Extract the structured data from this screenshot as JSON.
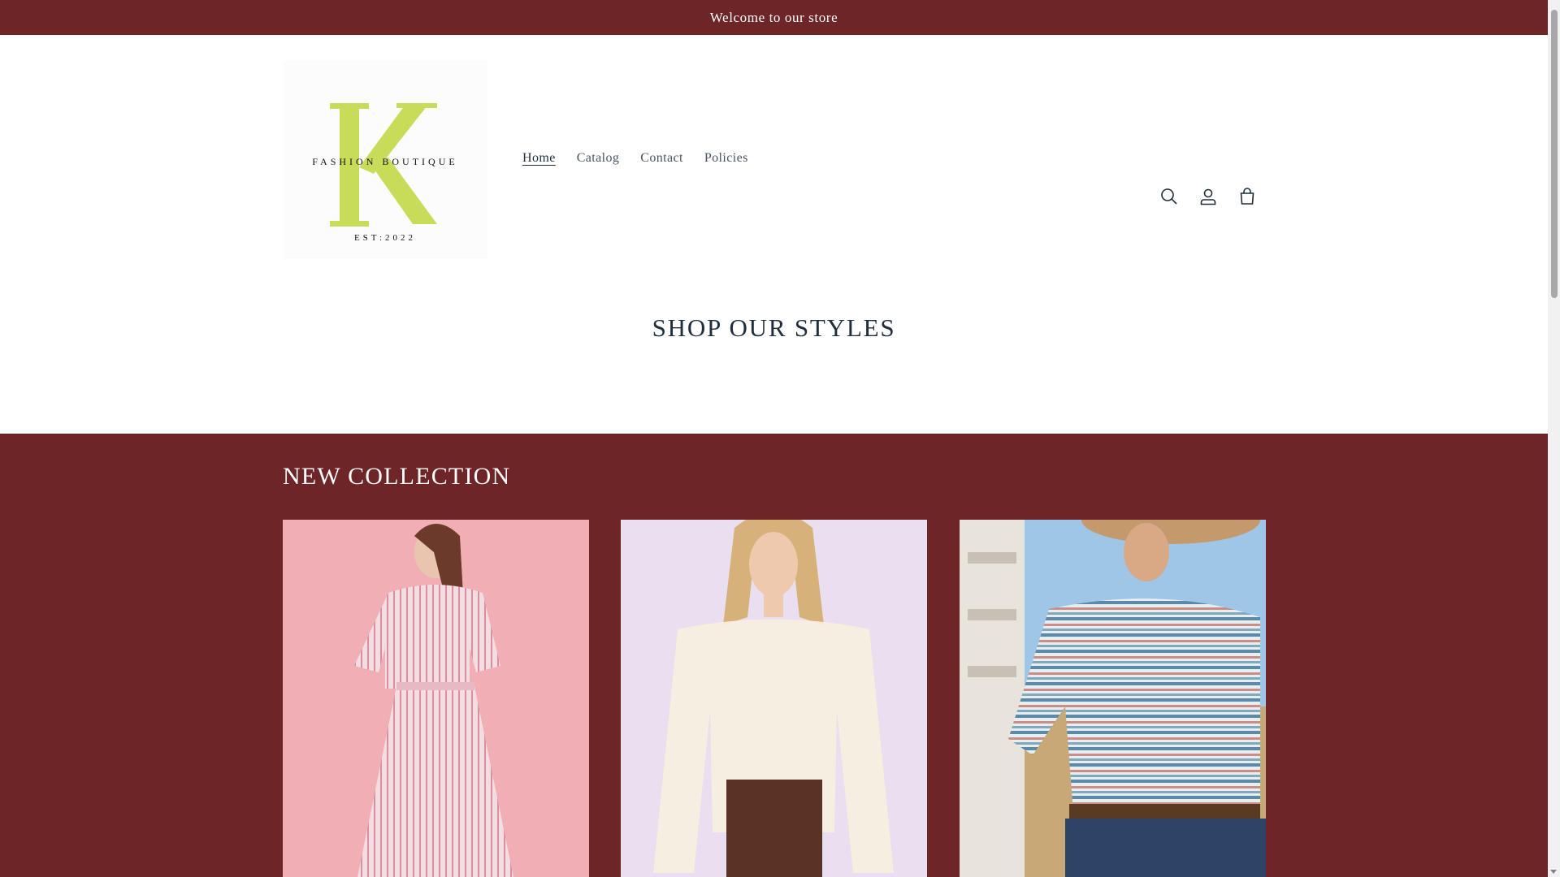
{
  "announcement": {
    "text": "Welcome to our store"
  },
  "logo": {
    "letter": "K",
    "line1": "FASHION BOUTIQUE",
    "line2": "EST:2022"
  },
  "nav": {
    "items": [
      {
        "label": "Home",
        "active": true
      },
      {
        "label": "Catalog"
      },
      {
        "label": "Contact"
      },
      {
        "label": "Policies"
      }
    ]
  },
  "header_icons": [
    "search-icon",
    "account-icon",
    "cart-icon"
  ],
  "hero": {
    "title": "SHOP OUR STYLES"
  },
  "collection": {
    "title": "NEW COLLECTION",
    "cards": [
      {
        "image": "pink striped shirt dress"
      },
      {
        "image": "sheer off-shoulder lace blouse with brown mini skirt"
      },
      {
        "image": "striped western polo shirt"
      }
    ]
  },
  "colors": {
    "brand": "#6e2527",
    "text": "#1f2d3d",
    "logo_accent": "#c9dc5a"
  }
}
